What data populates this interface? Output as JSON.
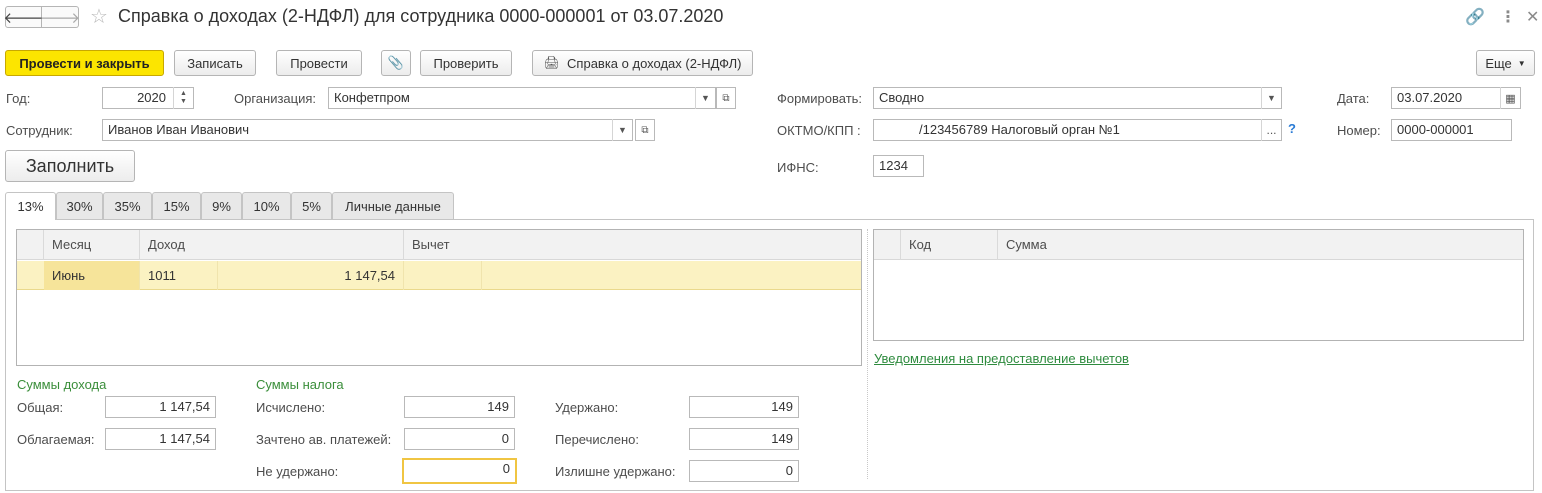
{
  "window": {
    "title": "Справка о доходах (2-НДФЛ) для сотрудника 0000-000001 от 03.07.2020",
    "back_icon": "arrow-left-icon",
    "forward_icon": "arrow-right-icon",
    "favorite_icon": "star-icon",
    "link_icon": "link-icon",
    "more_icon": "more-vertical-icon",
    "close_icon": "close-icon"
  },
  "toolbar": {
    "post_close": "Провести и закрыть",
    "save": "Записать",
    "post": "Провести",
    "attach_icon": "paperclip-icon",
    "check": "Проверить",
    "print": "Справка о доходах (2-НДФЛ)",
    "print_icon": "printer-icon",
    "more": "Еще"
  },
  "form": {
    "year_label": "Год:",
    "year_value": "2020",
    "org_label": "Организация:",
    "org_value": "Конфетпром",
    "employee_label": "Сотрудник:",
    "employee_value": "Иванов Иван Иванович",
    "form_label": "Формировать:",
    "form_value": "Сводно",
    "oktmo_label": "ОКТМО/КПП :",
    "oktmo_value": "/123456789 Налоговый орган №1",
    "oktmo_choose": "...",
    "oktmo_help": "?",
    "ifns_label": "ИФНС:",
    "ifns_value": "1234",
    "date_label": "Дата:",
    "date_value": "03.07.2020",
    "number_label": "Номер:",
    "number_value": "0000-000001",
    "fill_button": "Заполнить"
  },
  "tabs": [
    "13%",
    "30%",
    "35%",
    "15%",
    "9%",
    "10%",
    "5%",
    "Личные данные"
  ],
  "income_table": {
    "headers": [
      "Месяц",
      "Доход",
      "Вычет"
    ],
    "rows": [
      {
        "month": "Июнь",
        "income_code": "1011",
        "income_amount": "1 147,54",
        "deduction_code": "",
        "deduction_amount": ""
      }
    ]
  },
  "deduction_table": {
    "headers": [
      "Код",
      "Сумма"
    ]
  },
  "notifications_link": "Уведомления на предоставление вычетов",
  "income_sums": {
    "title": "Суммы дохода",
    "total_label": "Общая:",
    "total_value": "1 147,54",
    "taxable_label": "Облагаемая:",
    "taxable_value": "1 147,54"
  },
  "tax_sums": {
    "title": "Суммы налога",
    "calculated_label": "Исчислено:",
    "calculated_value": "149",
    "advance_label": "Зачтено ав. платежей:",
    "advance_value": "0",
    "not_withheld_label": "Не удержано:",
    "not_withheld_value": "0",
    "withheld_label": "Удержано:",
    "withheld_value": "149",
    "transferred_label": "Перечислено:",
    "transferred_value": "149",
    "excess_label": "Излишне удержано:",
    "excess_value": "0"
  }
}
